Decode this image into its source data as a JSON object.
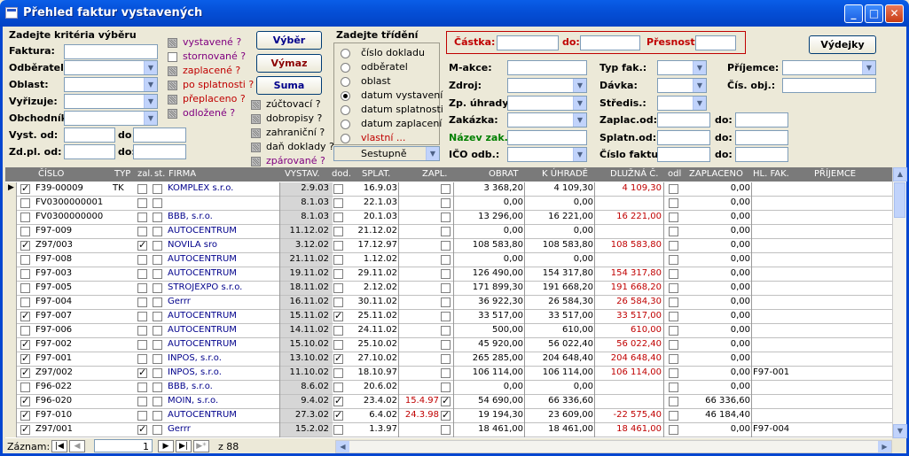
{
  "window": {
    "title": "Přehled faktur vystavených"
  },
  "criteria": {
    "heading": "Zadejte kritéria výběru",
    "labels": {
      "faktura": "Faktura:",
      "odberatel": "Odběratel:",
      "oblast": "Oblast:",
      "vyrizuje": "Vyřizuje:",
      "obchodnik": "Obchodník:",
      "vyst_od": "Vyst. od:",
      "zdpl_od": "Zd.pl. od:",
      "do1": "do",
      "do2": "do:"
    },
    "flags": [
      "vystavené ?",
      "stornované ?",
      "zaplacené ?",
      "po splatnosti ?",
      "přeplaceno ?",
      "odložené ?"
    ],
    "flags2": [
      "zúčtovací ?",
      "dobropisy ?",
      "zahraniční ?",
      "daň doklady ?",
      "zpárované ?"
    ]
  },
  "buttons": {
    "vyber": "Výběr",
    "vymaz": "Výmaz",
    "suma": "Suma",
    "vydejky": "Výdejky"
  },
  "sort": {
    "heading": "Zadejte třídění",
    "options": [
      "číslo dokladu",
      "odběratel",
      "oblast",
      "datum vystavení",
      "datum splatnosti",
      "datum zaplacení",
      "vlastní ..."
    ],
    "selected_index": 3,
    "direction": "Sestupně"
  },
  "amount": {
    "castka": "Částka:",
    "do": "do:",
    "presnost": "Přesnost:"
  },
  "right_labels": {
    "makce": "M-akce:",
    "zdroj": "Zdroj:",
    "zp_uhrady": "Zp. úhrady:",
    "zakazka": "Zakázka:",
    "nazev_zak": "Název zak.",
    "ico_odb": "IČO odb.:",
    "typ_fak": "Typ fak.:",
    "davka": "Dávka:",
    "stredis": "Středis.:",
    "zaplac_od": "Zaplac.od:",
    "splatn_od": "Splatn.od:",
    "cislo_faktur": "Číslo faktur",
    "prijemce": "Příjemce:",
    "cis_obj": "Čís. obj.:",
    "do": "do:"
  },
  "table": {
    "headers": [
      "ČÍSLO",
      "TYP",
      "zal.",
      "st.",
      "FIRMA",
      "VYSTAV.",
      "dod.",
      "SPLAT.",
      "ZAPL.",
      "OBRAT",
      "K ÚHRADĚ",
      "DLUŽNÁ Č.",
      "odl",
      "ZAPLACENO",
      "HL. FAK.",
      "PŘÍJEMCE"
    ],
    "rows": [
      {
        "sel": true,
        "cislo": "F39-00009",
        "typ": "TK",
        "zal": false,
        "st": false,
        "firma": "KOMPLEX s.r.o.",
        "vystav": "2.9.03",
        "dod": false,
        "splat": "16.9.03",
        "zapl": "",
        "zapl_chk": false,
        "obrat": "3 368,20",
        "uhrada": "4 109,30",
        "dluzna": "4 109,30",
        "odl": false,
        "zaplaceno": "0,00",
        "hlfak": ""
      },
      {
        "sel": false,
        "cislo": "FV0300000001",
        "typ": "",
        "zal": false,
        "st": false,
        "firma": "",
        "vystav": "8.1.03",
        "dod": false,
        "splat": "22.1.03",
        "zapl": "",
        "zapl_chk": false,
        "obrat": "0,00",
        "uhrada": "0,00",
        "dluzna": "",
        "odl": false,
        "zaplaceno": "0,00",
        "hlfak": ""
      },
      {
        "sel": false,
        "cislo": "FV0300000000",
        "typ": "",
        "zal": false,
        "st": false,
        "firma": "BBB, s.r.o.",
        "vystav": "8.1.03",
        "dod": false,
        "splat": "20.1.03",
        "zapl": "",
        "zapl_chk": false,
        "obrat": "13 296,00",
        "uhrada": "16 221,00",
        "dluzna": "16 221,00",
        "odl": false,
        "zaplaceno": "0,00",
        "hlfak": ""
      },
      {
        "sel": false,
        "cislo": "F97-009",
        "typ": "",
        "zal": false,
        "st": false,
        "firma": "AUTOCENTRUM",
        "vystav": "11.12.02",
        "dod": false,
        "splat": "21.12.02",
        "zapl": "",
        "zapl_chk": false,
        "obrat": "0,00",
        "uhrada": "0,00",
        "dluzna": "",
        "odl": false,
        "zaplaceno": "0,00",
        "hlfak": ""
      },
      {
        "sel": true,
        "cislo": "Z97/003",
        "typ": "",
        "zal": true,
        "st": false,
        "firma": "NOVILA sro",
        "vystav": "3.12.02",
        "dod": false,
        "splat": "17.12.97",
        "zapl": "",
        "zapl_chk": false,
        "obrat": "108 583,80",
        "uhrada": "108 583,80",
        "dluzna": "108 583,80",
        "odl": false,
        "zaplaceno": "0,00",
        "hlfak": ""
      },
      {
        "sel": false,
        "cislo": "F97-008",
        "typ": "",
        "zal": false,
        "st": false,
        "firma": "AUTOCENTRUM",
        "vystav": "21.11.02",
        "dod": false,
        "splat": "1.12.02",
        "zapl": "",
        "zapl_chk": false,
        "obrat": "0,00",
        "uhrada": "0,00",
        "dluzna": "",
        "odl": false,
        "zaplaceno": "0,00",
        "hlfak": ""
      },
      {
        "sel": false,
        "cislo": "F97-003",
        "typ": "",
        "zal": false,
        "st": false,
        "firma": "AUTOCENTRUM",
        "vystav": "19.11.02",
        "dod": false,
        "splat": "29.11.02",
        "zapl": "",
        "zapl_chk": false,
        "obrat": "126 490,00",
        "uhrada": "154 317,80",
        "dluzna": "154 317,80",
        "odl": false,
        "zaplaceno": "0,00",
        "hlfak": ""
      },
      {
        "sel": false,
        "cislo": "F97-005",
        "typ": "",
        "zal": false,
        "st": false,
        "firma": "STROJEXPO s.r.o.",
        "vystav": "18.11.02",
        "dod": false,
        "splat": "2.12.02",
        "zapl": "",
        "zapl_chk": false,
        "obrat": "171 899,30",
        "uhrada": "191 668,20",
        "dluzna": "191 668,20",
        "odl": false,
        "zaplaceno": "0,00",
        "hlfak": ""
      },
      {
        "sel": false,
        "cislo": "F97-004",
        "typ": "",
        "zal": false,
        "st": false,
        "firma": "Gerrr",
        "vystav": "16.11.02",
        "dod": false,
        "splat": "30.11.02",
        "zapl": "",
        "zapl_chk": false,
        "obrat": "36 922,30",
        "uhrada": "26 584,30",
        "dluzna": "26 584,30",
        "odl": false,
        "zaplaceno": "0,00",
        "hlfak": ""
      },
      {
        "sel": true,
        "cislo": "F97-007",
        "typ": "",
        "zal": false,
        "st": false,
        "firma": "AUTOCENTRUM",
        "vystav": "15.11.02",
        "dod": true,
        "splat": "25.11.02",
        "zapl": "",
        "zapl_chk": false,
        "obrat": "33 517,00",
        "uhrada": "33 517,00",
        "dluzna": "33 517,00",
        "odl": false,
        "zaplaceno": "0,00",
        "hlfak": ""
      },
      {
        "sel": false,
        "cislo": "F97-006",
        "typ": "",
        "zal": false,
        "st": false,
        "firma": "AUTOCENTRUM",
        "vystav": "14.11.02",
        "dod": false,
        "splat": "24.11.02",
        "zapl": "",
        "zapl_chk": false,
        "obrat": "500,00",
        "uhrada": "610,00",
        "dluzna": "610,00",
        "odl": false,
        "zaplaceno": "0,00",
        "hlfak": ""
      },
      {
        "sel": true,
        "cislo": "F97-002",
        "typ": "",
        "zal": false,
        "st": false,
        "firma": "AUTOCENTRUM",
        "vystav": "15.10.02",
        "dod": false,
        "splat": "25.10.02",
        "zapl": "",
        "zapl_chk": false,
        "obrat": "45 920,00",
        "uhrada": "56 022,40",
        "dluzna": "56 022,40",
        "odl": false,
        "zaplaceno": "0,00",
        "hlfak": ""
      },
      {
        "sel": true,
        "cislo": "F97-001",
        "typ": "",
        "zal": false,
        "st": false,
        "firma": "INPOS, s.r.o.",
        "vystav": "13.10.02",
        "dod": true,
        "splat": "27.10.02",
        "zapl": "",
        "zapl_chk": false,
        "obrat": "265 285,00",
        "uhrada": "204 648,40",
        "dluzna": "204 648,40",
        "odl": false,
        "zaplaceno": "0,00",
        "hlfak": ""
      },
      {
        "sel": true,
        "cislo": "Z97/002",
        "typ": "",
        "zal": true,
        "st": false,
        "firma": "INPOS, s.r.o.",
        "vystav": "11.10.02",
        "dod": false,
        "splat": "18.10.97",
        "zapl": "",
        "zapl_chk": false,
        "obrat": "106 114,00",
        "uhrada": "106 114,00",
        "dluzna": "106 114,00",
        "odl": false,
        "zaplaceno": "0,00",
        "hlfak": "F97-001"
      },
      {
        "sel": false,
        "cislo": "F96-022",
        "typ": "",
        "zal": false,
        "st": false,
        "firma": "BBB, s.r.o.",
        "vystav": "8.6.02",
        "dod": false,
        "splat": "20.6.02",
        "zapl": "",
        "zapl_chk": false,
        "obrat": "0,00",
        "uhrada": "0,00",
        "dluzna": "",
        "odl": false,
        "zaplaceno": "0,00",
        "hlfak": ""
      },
      {
        "sel": true,
        "cislo": "F96-020",
        "typ": "",
        "zal": false,
        "st": false,
        "firma": "MOIN, s.r.o.",
        "vystav": "9.4.02",
        "dod": true,
        "splat": "23.4.02",
        "zapl": "15.4.97",
        "zapl_chk": true,
        "obrat": "54 690,00",
        "uhrada": "66 336,60",
        "dluzna": "",
        "odl": false,
        "zaplaceno": "66 336,60",
        "hlfak": ""
      },
      {
        "sel": true,
        "cislo": "F97-010",
        "typ": "",
        "zal": false,
        "st": false,
        "firma": "AUTOCENTRUM",
        "vystav": "27.3.02",
        "dod": true,
        "splat": "6.4.02",
        "zapl": "24.3.98",
        "zapl_chk": true,
        "obrat": "19 194,30",
        "uhrada": "23 609,00",
        "dluzna": "-22 575,40",
        "odl": false,
        "zaplaceno": "46 184,40",
        "hlfak": ""
      },
      {
        "sel": true,
        "cislo": "Z97/001",
        "typ": "",
        "zal": true,
        "st": false,
        "firma": "Gerrr",
        "vystav": "15.2.02",
        "dod": false,
        "splat": "1.3.97",
        "zapl": "",
        "zapl_chk": false,
        "obrat": "18 461,00",
        "uhrada": "18 461,00",
        "dluzna": "18 461,00",
        "odl": false,
        "zaplaceno": "0,00",
        "hlfak": "F97-004"
      }
    ]
  },
  "nav": {
    "zaznam": "Záznam:",
    "current": "1",
    "of": "z  88"
  }
}
